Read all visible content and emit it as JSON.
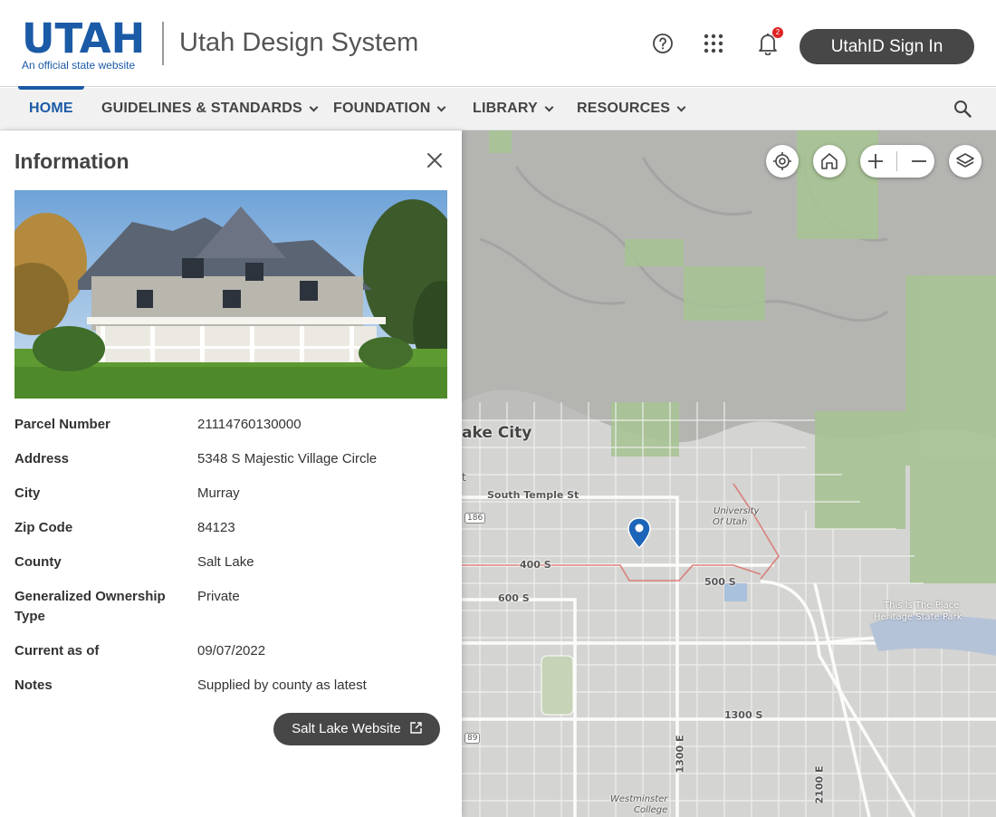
{
  "header": {
    "logo_text": "UTAH",
    "logo_tagline": "An official state website",
    "site_title": "Utah Design System",
    "notification_count": "2",
    "signin_label": "UtahID Sign In"
  },
  "nav": {
    "items": [
      {
        "label": "HOME",
        "active": true,
        "has_menu": false
      },
      {
        "label": "GUIDELINES & STANDARDS",
        "has_menu": true
      },
      {
        "label": "FOUNDATION",
        "has_menu": true
      },
      {
        "label": "LIBRARY",
        "has_menu": true
      },
      {
        "label": "RESOURCES",
        "has_menu": true
      }
    ]
  },
  "panel": {
    "title": "Information",
    "fields": [
      {
        "label": "Parcel Number",
        "value": "21114760130000"
      },
      {
        "label": "Address",
        "value": "5348 S Majestic Village Circle"
      },
      {
        "label": "City",
        "value": "Murray"
      },
      {
        "label": "Zip Code",
        "value": "84123"
      },
      {
        "label": "County",
        "value": "Salt Lake"
      },
      {
        "label": "Generalized Ownership",
        "label2": "Type",
        "value": "Private"
      },
      {
        "label": "Current as of",
        "value": "09/07/2022"
      },
      {
        "label": "Notes",
        "value": "Supplied by county as latest"
      }
    ],
    "external_button_label": "Salt Lake Website"
  },
  "map": {
    "labels": {
      "city": "ake City",
      "south_temple": "South Temple St",
      "s400": "400 S",
      "s500": "500 S",
      "s600": "600 S",
      "s1300": "1300 S",
      "e1300": "1300 E",
      "e2100": "2100 E",
      "university_1": "University",
      "university_2": "Of Utah",
      "park_1": "This Is The Place",
      "park_2": "Heritage State Park",
      "westminster_1": "Westminster",
      "westminster_2": "College",
      "hwy_186": "186",
      "hwy_89": "89",
      "st": "t"
    }
  },
  "colors": {
    "brand": "#1b5aa6",
    "button": "#474747",
    "badge": "#dd2222",
    "marker": "#1b64b8"
  }
}
